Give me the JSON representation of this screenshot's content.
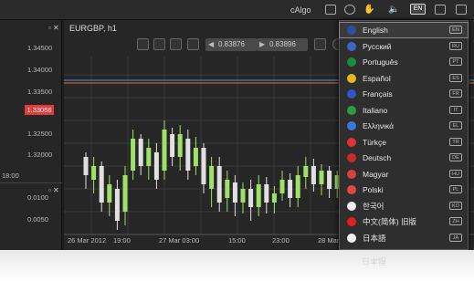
{
  "topbar": {
    "brand": "cAlgo",
    "lang_badge": "EN"
  },
  "left_panel": {
    "ticks": [
      "1.34500",
      "1.34000",
      "1.33500",
      "1.33000",
      "1.32500",
      "1.32000",
      "0.0100",
      "0.0050"
    ],
    "price_label": "1.33056",
    "bottom_time": "18:00"
  },
  "chart": {
    "title": "EURGBP, h1",
    "bid": "0.83876",
    "ask": "0.83896",
    "x_labels": [
      "26 Mar 2012",
      "19:00",
      "27 Mar 03:00",
      "15:00",
      "23:00",
      "28 Mar 0"
    ]
  },
  "chart_data": {
    "type": "candlestick",
    "x": [
      "26 Mar 2012",
      "19:00",
      "27 Mar 03:00",
      "15:00",
      "23:00",
      "28 Mar 0"
    ],
    "candles": [
      {
        "o": 150,
        "c": 170,
        "h": 145,
        "l": 185
      },
      {
        "o": 175,
        "c": 160,
        "h": 150,
        "l": 190
      },
      {
        "o": 160,
        "c": 200,
        "h": 155,
        "l": 210
      },
      {
        "o": 200,
        "c": 180,
        "h": 170,
        "l": 215
      },
      {
        "o": 185,
        "c": 220,
        "h": 175,
        "l": 230
      },
      {
        "o": 210,
        "c": 170,
        "h": 160,
        "l": 225
      },
      {
        "o": 165,
        "c": 130,
        "h": 120,
        "l": 175
      },
      {
        "o": 130,
        "c": 160,
        "h": 125,
        "l": 170
      },
      {
        "o": 160,
        "c": 140,
        "h": 130,
        "l": 175
      },
      {
        "o": 145,
        "c": 175,
        "h": 135,
        "l": 185
      },
      {
        "o": 165,
        "c": 120,
        "h": 110,
        "l": 175
      },
      {
        "o": 125,
        "c": 150,
        "h": 118,
        "l": 160
      },
      {
        "o": 150,
        "c": 125,
        "h": 115,
        "l": 165
      },
      {
        "o": 130,
        "c": 165,
        "h": 120,
        "l": 175
      },
      {
        "o": 160,
        "c": 140,
        "h": 128,
        "l": 170
      },
      {
        "o": 140,
        "c": 180,
        "h": 135,
        "l": 190
      },
      {
        "o": 185,
        "c": 160,
        "h": 150,
        "l": 205
      },
      {
        "o": 160,
        "c": 200,
        "h": 150,
        "l": 210
      },
      {
        "o": 195,
        "c": 175,
        "h": 165,
        "l": 210
      },
      {
        "o": 178,
        "c": 200,
        "h": 170,
        "l": 215
      },
      {
        "o": 200,
        "c": 185,
        "h": 178,
        "l": 212
      },
      {
        "o": 185,
        "c": 205,
        "h": 175,
        "l": 220
      },
      {
        "o": 205,
        "c": 180,
        "h": 170,
        "l": 215
      },
      {
        "o": 180,
        "c": 200,
        "h": 172,
        "l": 212
      },
      {
        "o": 200,
        "c": 190,
        "h": 182,
        "l": 212
      },
      {
        "o": 190,
        "c": 175,
        "h": 165,
        "l": 198
      },
      {
        "o": 175,
        "c": 195,
        "h": 168,
        "l": 205
      },
      {
        "o": 195,
        "c": 170,
        "h": 160,
        "l": 205
      },
      {
        "o": 172,
        "c": 160,
        "h": 150,
        "l": 185
      },
      {
        "o": 160,
        "c": 180,
        "h": 152,
        "l": 188
      },
      {
        "o": 180,
        "c": 165,
        "h": 158,
        "l": 192
      },
      {
        "o": 165,
        "c": 185,
        "h": 160,
        "l": 195
      },
      {
        "o": 185,
        "c": 170,
        "h": 165,
        "l": 195
      },
      {
        "o": 172,
        "c": 150,
        "h": 140,
        "l": 180
      },
      {
        "o": 150,
        "c": 130,
        "h": 60,
        "l": 160
      }
    ]
  },
  "lang_menu": {
    "items": [
      {
        "label": "English",
        "code": "EN",
        "color": "#2c4fa3"
      },
      {
        "label": "Русский",
        "code": "RU",
        "color": "#3b66c9"
      },
      {
        "label": "Português",
        "code": "PT",
        "color": "#1f8a3a"
      },
      {
        "label": "Español",
        "code": "ES",
        "color": "#e6b81e"
      },
      {
        "label": "Français",
        "code": "FR",
        "color": "#2f56c7"
      },
      {
        "label": "Italiano",
        "code": "IT",
        "color": "#2f9a46"
      },
      {
        "label": "Ελληνικά",
        "code": "EL",
        "color": "#3a7ad6"
      },
      {
        "label": "Türkçe",
        "code": "TR",
        "color": "#e03333"
      },
      {
        "label": "Deutsch",
        "code": "DE",
        "color": "#cc2b2b"
      },
      {
        "label": "Magyar",
        "code": "HU",
        "color": "#d94040"
      },
      {
        "label": "Polski",
        "code": "PL",
        "color": "#e04848"
      },
      {
        "label": "한국어",
        "code": "KO",
        "color": "#eeeeee"
      },
      {
        "label": "中文(简体) 旧版",
        "code": "ZH",
        "color": "#e02020"
      },
      {
        "label": "日本語",
        "code": "JA",
        "color": "#f2f2f2"
      }
    ],
    "reflection_label": "日本語"
  }
}
